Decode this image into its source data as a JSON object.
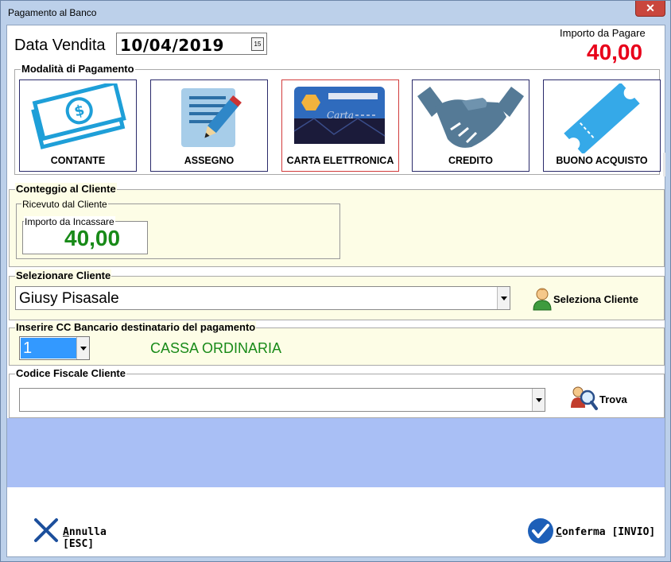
{
  "window": {
    "title": "Pagamento al Banco",
    "close_glyph": "✕"
  },
  "header": {
    "data_label": "Data Vendita",
    "data_value": "10/04/2019",
    "calendar_glyph": "15",
    "importo_label": "Importo da Pagare",
    "importo_value": "40,00"
  },
  "modalita": {
    "title": "Modalità di Pagamento",
    "buttons": [
      {
        "label": "CONTANTE",
        "icon": "cash-icon"
      },
      {
        "label": "ASSEGNO",
        "icon": "cheque-icon"
      },
      {
        "label": "CARTA ELETTRONICA",
        "icon": "credit-card-icon",
        "selected": true
      },
      {
        "label": "CREDITO",
        "icon": "handshake-icon"
      },
      {
        "label": "BUONO ACQUISTO",
        "icon": "voucher-icon"
      }
    ]
  },
  "conteggio": {
    "title": "Conteggio al Cliente",
    "ricevuto_label": "Ricevuto dal Cliente",
    "incassare_label": "Importo da Incassare",
    "incassare_value": "40,00"
  },
  "cliente": {
    "title": "Selezionare Cliente",
    "value": "Giusy Pisasale",
    "button_label": "Seleziona Cliente"
  },
  "cc": {
    "title": "Inserire CC Bancario destinatario del pagamento",
    "value": "1",
    "description": "CASSA ORDINARIA"
  },
  "codice_fiscale": {
    "title": "Codice Fiscale Cliente",
    "value": "",
    "button_label": "Trova"
  },
  "footer": {
    "annulla_u": "A",
    "annulla_rest": "nnulla [ESC]",
    "conferma_u": "C",
    "conferma_rest": "onferma [INVIO]"
  },
  "colors": {
    "importo": "#e8001a",
    "green_text": "#188a18",
    "band": "#a9bff5",
    "selection": "#3399ff"
  }
}
